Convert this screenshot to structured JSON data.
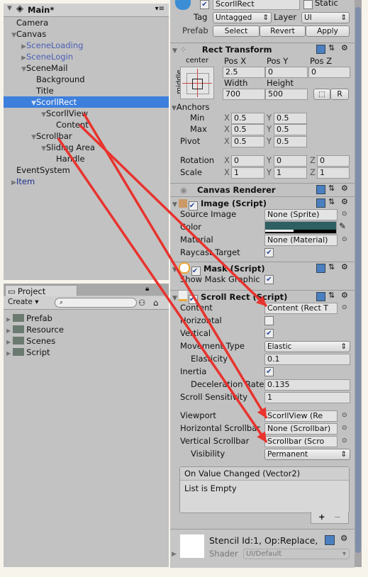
{
  "hierarchy": {
    "scene": "Main*",
    "items": [
      {
        "label": "Camera",
        "depth": 1,
        "arrow": "",
        "style": "normal"
      },
      {
        "label": "Canvas",
        "depth": 1,
        "arrow": "▼",
        "style": "normal"
      },
      {
        "label": "SceneLoading",
        "depth": 2,
        "arrow": "▶",
        "style": "blue"
      },
      {
        "label": "SceneLogin",
        "depth": 2,
        "arrow": "▶",
        "style": "blue"
      },
      {
        "label": "SceneMail",
        "depth": 2,
        "arrow": "▼",
        "style": "normal"
      },
      {
        "label": "Background",
        "depth": 3,
        "arrow": "",
        "style": "normal"
      },
      {
        "label": "Title",
        "depth": 3,
        "arrow": "",
        "style": "normal"
      },
      {
        "label": "ScorllRect",
        "depth": 3,
        "arrow": "▼",
        "style": "selected"
      },
      {
        "label": "ScorllView",
        "depth": 4,
        "arrow": "▼",
        "style": "normal"
      },
      {
        "label": "Content",
        "depth": 5,
        "arrow": "",
        "style": "normal"
      },
      {
        "label": "Scrollbar",
        "depth": 3,
        "arrow": "▼",
        "style": "normal"
      },
      {
        "label": "Sliding Area",
        "depth": 4,
        "arrow": "▼",
        "style": "normal"
      },
      {
        "label": "Handle",
        "depth": 5,
        "arrow": "",
        "style": "normal"
      },
      {
        "label": "EventSystem",
        "depth": 1,
        "arrow": "",
        "style": "normal"
      },
      {
        "label": "Item",
        "depth": 1,
        "arrow": "▶",
        "style": "darkblue"
      }
    ]
  },
  "project": {
    "tab": "Project",
    "create": "Create",
    "folders": [
      "Prefab",
      "Resource",
      "Scenes",
      "Script"
    ]
  },
  "inspector": {
    "name": "ScorllRect",
    "static": "Static",
    "tag_label": "Tag",
    "tag": "Untagged",
    "layer_label": "Layer",
    "layer": "UI",
    "prefab_label": "Prefab",
    "select": "Select",
    "revert": "Revert",
    "apply": "Apply",
    "rect": {
      "title": "Rect Transform",
      "anchor_h": "center",
      "anchor_v": "middle",
      "posx_l": "Pos X",
      "posy_l": "Pos Y",
      "posz_l": "Pos Z",
      "posx": "2.5",
      "posy": "0",
      "posz": "0",
      "width_l": "Width",
      "height_l": "Height",
      "width": "700",
      "height": "500",
      "r": "R",
      "anchors": "Anchors",
      "min": "Min",
      "max": "Max",
      "pivot": "Pivot",
      "min_x": "0.5",
      "min_y": "0.5",
      "max_x": "0.5",
      "max_y": "0.5",
      "pivot_x": "0.5",
      "pivot_y": "0.5",
      "rotation": "Rotation",
      "scale": "Scale",
      "rot_x": "0",
      "rot_y": "0",
      "rot_z": "0",
      "sc_x": "1",
      "sc_y": "1",
      "sc_z": "1",
      "X": "X",
      "Y": "Y",
      "Z": "Z"
    },
    "canvas_renderer": "Canvas Renderer",
    "image": {
      "title": "Image (Script)",
      "source_l": "Source Image",
      "source": "None (Sprite)",
      "color_l": "Color",
      "color": "#2e5f62",
      "material_l": "Material",
      "material": "None (Material)",
      "raycast_l": "Raycast Target",
      "raycast": true
    },
    "mask": {
      "title": "Mask (Script)",
      "show_l": "Show Mask Graphic",
      "show": true
    },
    "scroll": {
      "title": "Scroll Rect (Script)",
      "content_l": "Content",
      "content": "Content (Rect T",
      "horizontal_l": "Horizontal",
      "horizontal": false,
      "vertical_l": "Vertical",
      "vertical": true,
      "movement_l": "Movement Type",
      "movement": "Elastic",
      "elasticity_l": "Elasticity",
      "elasticity": "0.1",
      "inertia_l": "Inertia",
      "inertia": true,
      "decel_l": "Deceleration Rate",
      "decel": "0.135",
      "sens_l": "Scroll Sensitivity",
      "sens": "1",
      "viewport_l": "Viewport",
      "viewport": "ScorllView (Re",
      "hbar_l": "Horizontal Scrollbar",
      "hbar": "None (Scrollbar)",
      "vbar_l": "Vertical Scrollbar",
      "vbar": "Scrollbar (Scro",
      "visibility_l": "Visibility",
      "visibility": "Permanent",
      "event": "On Value Changed (Vector2)",
      "empty": "List is Empty",
      "plus": "+",
      "minus": "−"
    },
    "material_preview": {
      "text": "Stencil Id:1, Op:Replace,",
      "shader_l": "Shader",
      "shader": "UI/Default"
    }
  },
  "annotation_color": "#e8332e"
}
